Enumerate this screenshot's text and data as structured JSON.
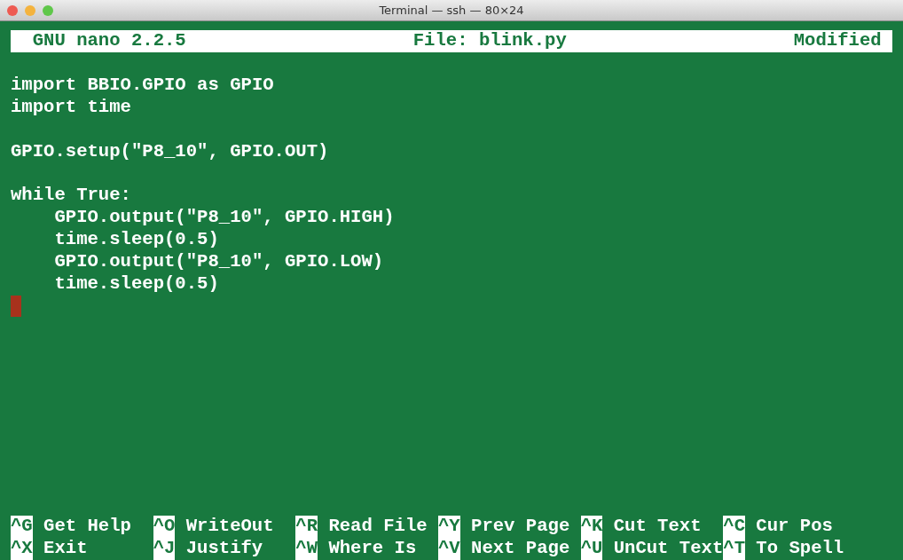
{
  "window": {
    "title": "Terminal — ssh — 80×24"
  },
  "header": {
    "app": "GNU nano 2.2.5",
    "file": "File: blink.py",
    "status": "Modified"
  },
  "code": "import BBIO.GPIO as GPIO\nimport time\n\nGPIO.setup(\"P8_10\", GPIO.OUT)\n\nwhile True:\n    GPIO.output(\"P8_10\", GPIO.HIGH)\n    time.sleep(0.5)\n    GPIO.output(\"P8_10\", GPIO.LOW)\n    time.sleep(0.5)",
  "shortcuts": [
    [
      {
        "key": "^G",
        "label": "Get Help"
      },
      {
        "key": "^O",
        "label": "WriteOut"
      },
      {
        "key": "^R",
        "label": "Read File"
      },
      {
        "key": "^Y",
        "label": "Prev Page"
      },
      {
        "key": "^K",
        "label": "Cut Text"
      },
      {
        "key": "^C",
        "label": "Cur Pos"
      }
    ],
    [
      {
        "key": "^X",
        "label": "Exit"
      },
      {
        "key": "^J",
        "label": "Justify"
      },
      {
        "key": "^W",
        "label": "Where Is"
      },
      {
        "key": "^V",
        "label": "Next Page"
      },
      {
        "key": "^U",
        "label": "UnCut Text"
      },
      {
        "key": "^T",
        "label": "To Spell"
      }
    ]
  ]
}
